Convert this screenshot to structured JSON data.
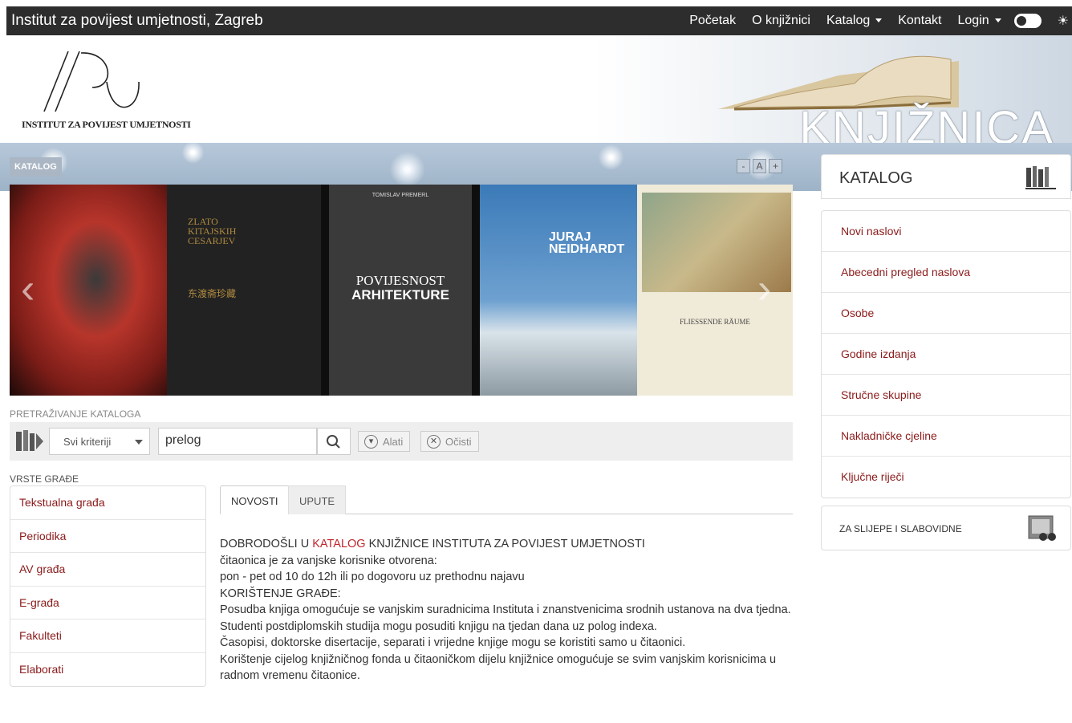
{
  "topbar": {
    "brand": "Institut za povijest umjetnosti, Zagreb",
    "nav": [
      "Početak",
      "O knjižnici",
      "Katalog",
      "Kontakt",
      "Login"
    ]
  },
  "banner": {
    "logo_text": "INSTITUT ZA POVIJEST UMJETNOSTI",
    "title": "KNJIŽNICA"
  },
  "strip": {
    "tag": "KATALOG",
    "font_controls": [
      "-",
      "A",
      "+"
    ]
  },
  "carousel": {
    "book2_title": "ZLATO\nKITAJSKIH\nCESARJEV",
    "book2_sub": "东渡斋珍藏",
    "book3_author": "TOMISLAV PREMERL",
    "book3_title1": "POVIJESNOST",
    "book3_title2": "ARHITEKTURE",
    "book4_title": "JURAJ\nNEIDHARDT",
    "book5_title": "FLIESSENDE RÄUME"
  },
  "search": {
    "label": "PRETRAŽIVANJE KATALOGA",
    "criteria": "Svi kriteriji",
    "query": "prelog",
    "tools_label": "Alati",
    "clear_label": "Očisti"
  },
  "vrste": {
    "label": "VRSTE GRAĐE",
    "items": [
      "Tekstualna građa",
      "Periodika",
      "AV građa",
      "E-građa",
      "Fakulteti",
      "Elaborati"
    ]
  },
  "tabs": [
    "NOVOSTI",
    "UPUTE"
  ],
  "news": {
    "headline_pre": "DOBRODOŠLI U ",
    "headline_link": "KATALOG",
    "headline_post": " KNJIŽNICE INSTITUTA ZA POVIJEST UMJETNOSTI",
    "lines": [
      "čitaonica je za vanjske korisnike otvorena:",
      "pon - pet od 10 do 12h ili po dogovoru uz prethodnu najavu",
      "KORIŠTENJE GRAĐE:",
      "Posudba knjiga omogućuje se vanjskim suradnicima Instituta i znanstvenicima srodnih ustanova na dva tjedna.",
      "Studenti postdiplomskih studija mogu posuditi knjigu na tjedan dana uz polog indexa.",
      "Časopisi, doktorske disertacije, separati i vrijedne knjige mogu se koristiti samo u čitaonici.",
      "Korištenje cijelog knjižničnog fonda u čitaoničkom dijelu knjižnice omogućuje se svim vanjskim korisnicima u radnom vremenu čitaonice."
    ]
  },
  "sidebar": {
    "title": "KATALOG",
    "items": [
      "Novi naslovi",
      "Abecedni pregled naslova",
      "Osobe",
      "Godine izdanja",
      "Stručne skupine",
      "Nakladničke cjeline",
      "Ključne riječi"
    ],
    "accessibility": "ZA SLIJEPE I SLABOVIDNE"
  }
}
